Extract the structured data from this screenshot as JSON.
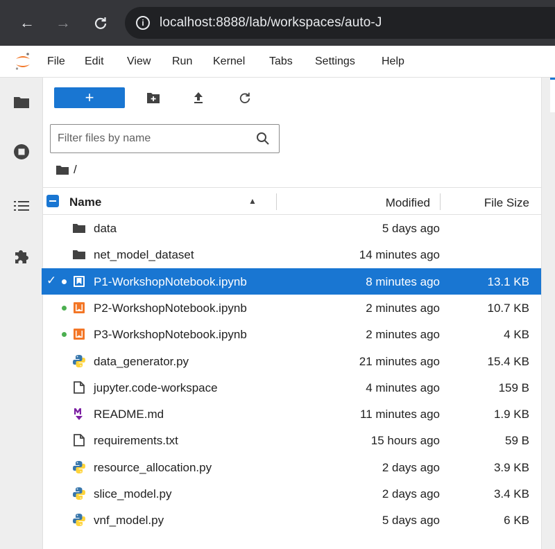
{
  "browser": {
    "url": "localhost:8888/lab/workspaces/auto-J"
  },
  "menu": {
    "items": [
      "File",
      "Edit",
      "View",
      "Run",
      "Kernel",
      "Tabs",
      "Settings",
      "Help"
    ]
  },
  "toolbar": {
    "new_label": "+"
  },
  "filter": {
    "placeholder": "Filter files by name"
  },
  "breadcrumb": {
    "path": "/"
  },
  "table": {
    "columns": {
      "name": "Name",
      "modified": "Modified",
      "size": "File Size"
    },
    "rows": [
      {
        "name": "data",
        "type": "folder",
        "modified": "5 days ago",
        "size": ""
      },
      {
        "name": "net_model_dataset",
        "type": "folder",
        "modified": "14 minutes ago",
        "size": ""
      },
      {
        "name": "P1-WorkshopNotebook.ipynb",
        "type": "notebook",
        "modified": "8 minutes ago",
        "size": "13.1 KB",
        "selected": true,
        "running": true
      },
      {
        "name": "P2-WorkshopNotebook.ipynb",
        "type": "notebook",
        "modified": "2 minutes ago",
        "size": "10.7 KB",
        "running": true
      },
      {
        "name": "P3-WorkshopNotebook.ipynb",
        "type": "notebook",
        "modified": "2 minutes ago",
        "size": "4 KB",
        "running": true
      },
      {
        "name": "data_generator.py",
        "type": "python",
        "modified": "21 minutes ago",
        "size": "15.4 KB"
      },
      {
        "name": "jupyter.code-workspace",
        "type": "file",
        "modified": "4 minutes ago",
        "size": "159 B"
      },
      {
        "name": "README.md",
        "type": "markdown",
        "modified": "11 minutes ago",
        "size": "1.9 KB"
      },
      {
        "name": "requirements.txt",
        "type": "file",
        "modified": "15 hours ago",
        "size": "59 B"
      },
      {
        "name": "resource_allocation.py",
        "type": "python",
        "modified": "2 days ago",
        "size": "3.9 KB"
      },
      {
        "name": "slice_model.py",
        "type": "python",
        "modified": "2 days ago",
        "size": "3.4 KB"
      },
      {
        "name": "vnf_model.py",
        "type": "python",
        "modified": "5 days ago",
        "size": "6 KB"
      }
    ]
  },
  "colors": {
    "accent": "#1976d2",
    "notebook": "#f37626",
    "markdown": "#7b1fa2",
    "running_dot": "#4caf50",
    "python_blue": "#3776ab",
    "python_yellow": "#ffd43b"
  }
}
